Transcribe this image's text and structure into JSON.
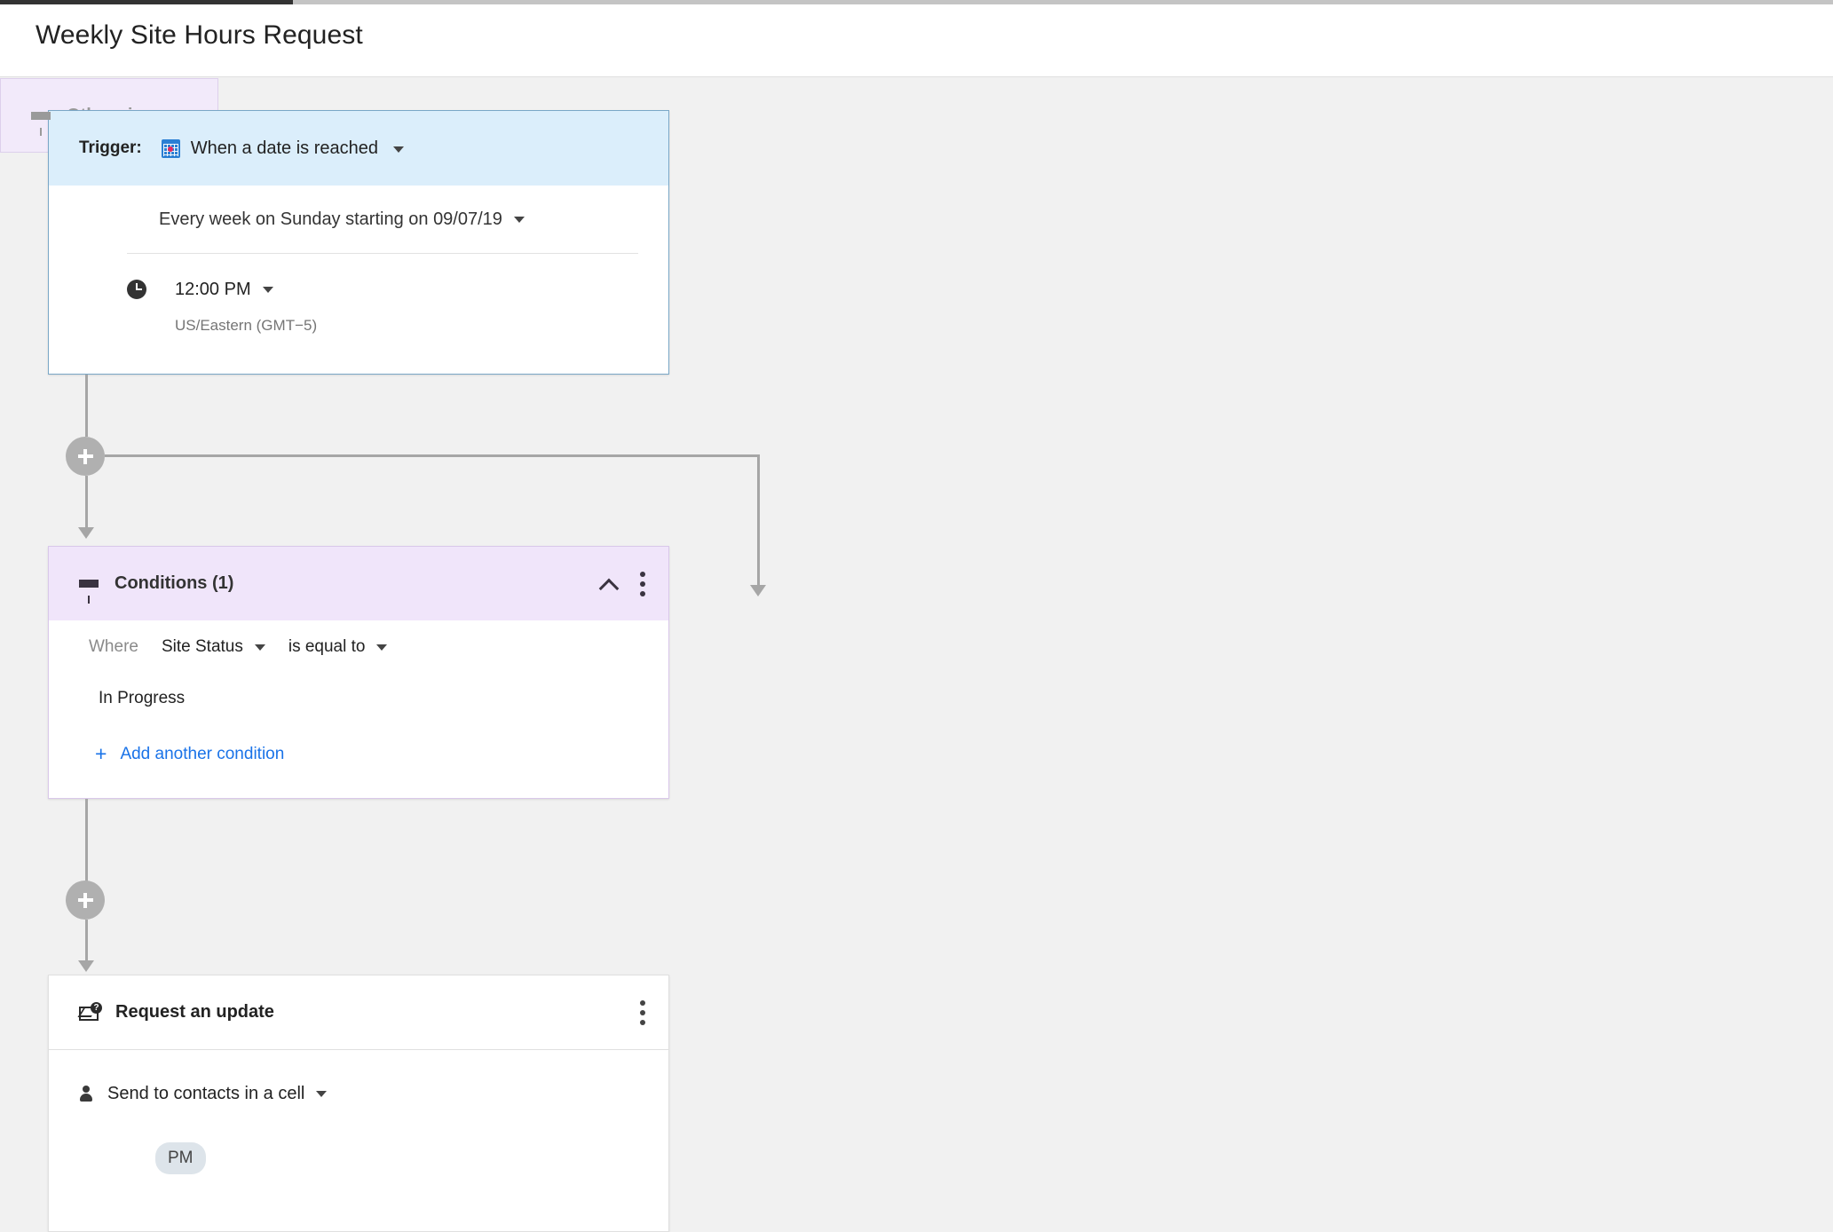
{
  "header": {
    "title": "Weekly Site Hours Request"
  },
  "colors": {
    "trigger_header_bg": "#dbeefb",
    "trigger_border": "#7aa7c7",
    "conditions_header_bg": "#f0e5fa",
    "conditions_border": "#d9c8ea",
    "otherwise_bg": "#f2eafa",
    "link_blue": "#1a73e8",
    "connector_grey": "#a6a6a6",
    "plus_node_grey": "#b0b0b0",
    "chip_bg": "#dde4ea",
    "canvas_bg": "#f1f1f1",
    "calendar_icon_blue": "#2a7fd4",
    "calendar_icon_dot": "#e8295e"
  },
  "trigger": {
    "label": "Trigger:",
    "icon": "calendar-icon",
    "type_value": "When a date is reached",
    "schedule_value": "Every week on Sunday starting on 09/07/19",
    "time_icon": "clock-icon",
    "time_value": "12:00 PM",
    "timezone": "US/Eastern (GMT−5)"
  },
  "add_node_1": {
    "icon": "plus-icon"
  },
  "conditions": {
    "icon": "funnel-icon",
    "title": "Conditions (1)",
    "collapse_icon": "chevron-up-icon",
    "menu_icon": "kebab-menu-icon",
    "where_label": "Where",
    "field_value": "Site Status",
    "operator_value": "is equal to",
    "condition_value": "In Progress",
    "add_another_plus": "+",
    "add_another_label": "Add another condition"
  },
  "otherwise": {
    "icon": "funnel-icon",
    "title": "Otherwise"
  },
  "add_node_2": {
    "icon": "plus-icon"
  },
  "request_update": {
    "icon": "mail-question-icon",
    "title": "Request an update",
    "menu_icon": "kebab-menu-icon",
    "recipient_icon": "person-icon",
    "send_to_value": "Send to contacts in a cell",
    "chip_label": "PM"
  }
}
